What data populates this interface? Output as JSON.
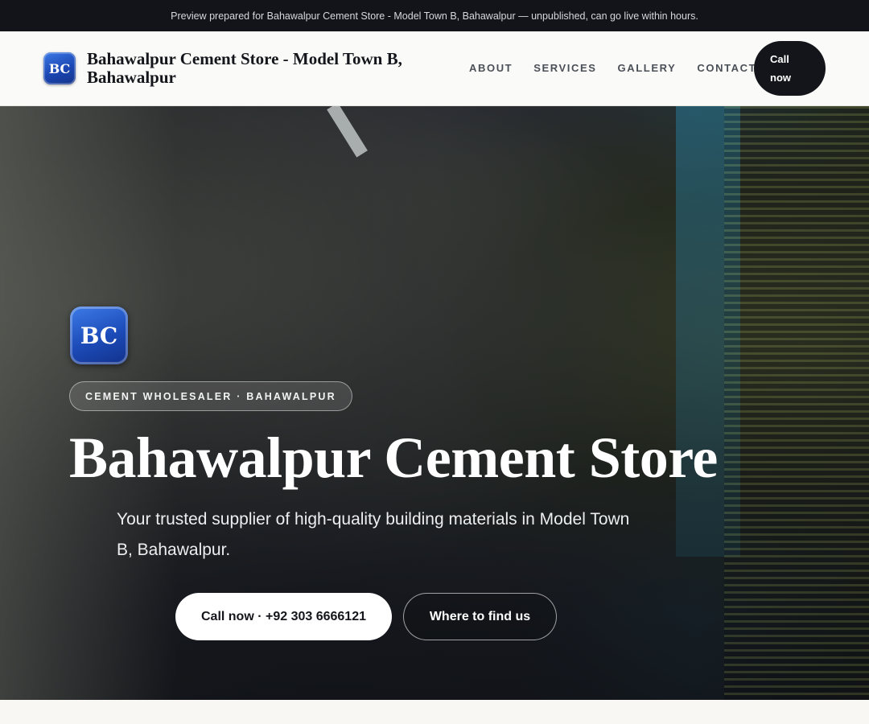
{
  "preview_banner": "Preview prepared for Bahawalpur Cement Store - Model Town B, Bahawalpur — unpublished, can go live within hours.",
  "header": {
    "logo_initials": "BC",
    "brand_name": "Bahawalpur Cement Store - Model Town B, Bahawalpur",
    "nav": [
      "ABOUT",
      "SERVICES",
      "GALLERY",
      "CONTACT"
    ],
    "call_button": "Call now"
  },
  "hero": {
    "logo_initials": "BC",
    "badge": "CEMENT WHOLESALER · BAHAWALPUR",
    "title": "Bahawalpur Cement Store",
    "subtitle": "Your trusted supplier of high-quality building materials in Model Town B, Bahawalpur.",
    "primary_button": "Call now · +92 303 6666121",
    "secondary_button": "Where to find us"
  },
  "colors": {
    "dark": "#14151a",
    "logo_blue": "#1b47b3"
  }
}
